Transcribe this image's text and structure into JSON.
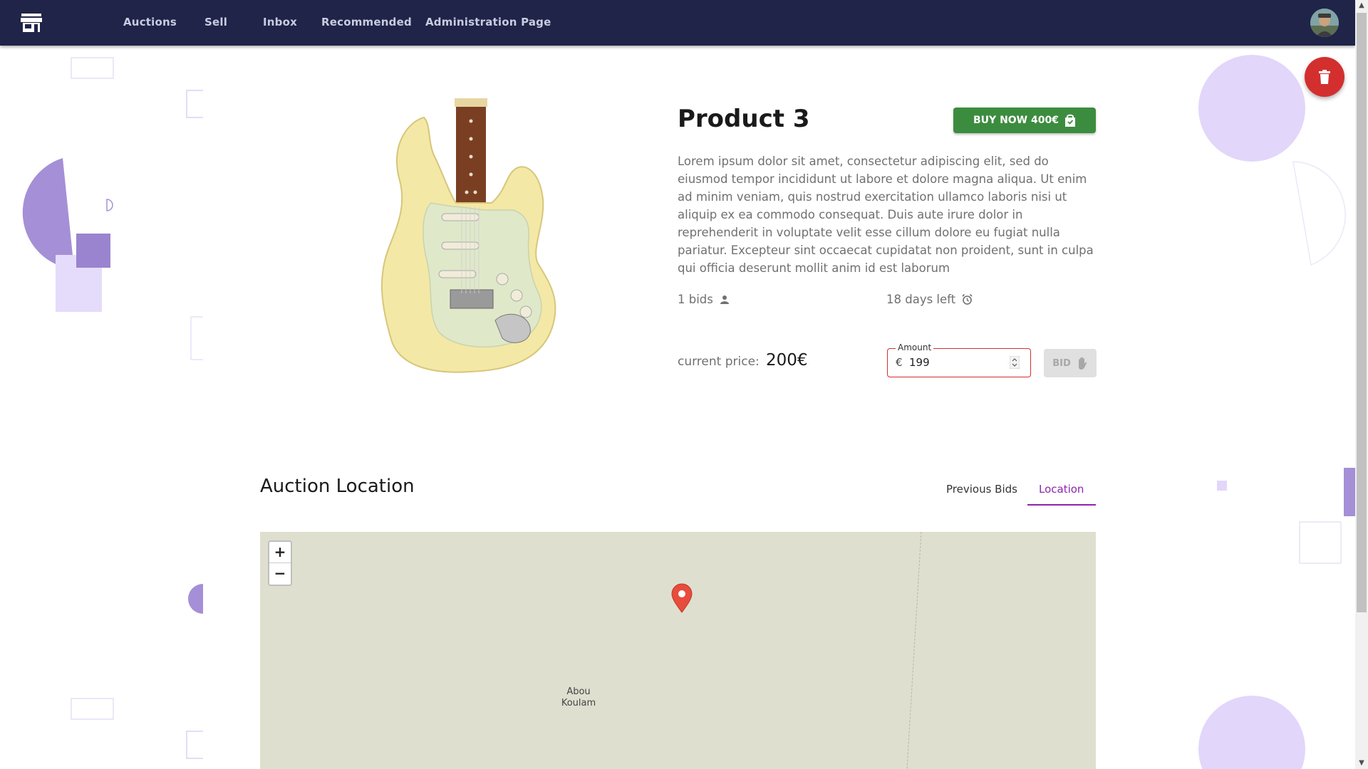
{
  "nav": {
    "items": [
      {
        "label": "Auctions"
      },
      {
        "label": "Sell"
      },
      {
        "label": "Inbox"
      },
      {
        "label": "Recommended"
      },
      {
        "label": "Administration Page"
      }
    ]
  },
  "product": {
    "title": "Product 3",
    "buy_now_label": "BUY NOW 400€",
    "description": "Lorem ipsum dolor sit amet, consectetur adipiscing elit, sed do eiusmod tempor incididunt ut labore et dolore magna aliqua. Ut enim ad minim veniam, quis nostrud exercitation ullamco laboris nisi ut aliquip ex ea commodo consequat. Duis aute irure dolor in reprehenderit in voluptate velit esse cillum dolore eu fugiat nulla pariatur. Excepteur sint occaecat cupidatat non proident, sunt in culpa qui officia deserunt mollit anim id est laborum",
    "bids": "1 bids",
    "time_left": "18 days left",
    "current_price_label": "current price:",
    "current_price": "200€"
  },
  "bid_form": {
    "amount_label": "Amount",
    "currency_prefix": "€",
    "amount_value": "199",
    "bid_label": "BID"
  },
  "location": {
    "section_title": "Auction Location",
    "tabs": [
      {
        "label": "Previous Bids",
        "active": false
      },
      {
        "label": "Location",
        "active": true
      }
    ],
    "map": {
      "zoom_in": "+",
      "zoom_out": "−",
      "place_label_line1": "Abou",
      "place_label_line2": "Koulam"
    }
  },
  "icons": {
    "logo": "store-icon",
    "buy_now": "shopping-bag-icon",
    "bids": "person-icon",
    "time": "alarm-clock-icon",
    "bid": "hand-icon",
    "delete": "trash-icon",
    "map_marker": "map-pin-icon"
  },
  "colors": {
    "navbar": "#1f2448",
    "buy_now": "#3c8c3f",
    "delete": "#d32f2f",
    "active_tab": "#8e24aa",
    "error_outline": "#d32f2f",
    "map_background": "#dfdfd0",
    "decor_purple": "#b39ddb"
  }
}
